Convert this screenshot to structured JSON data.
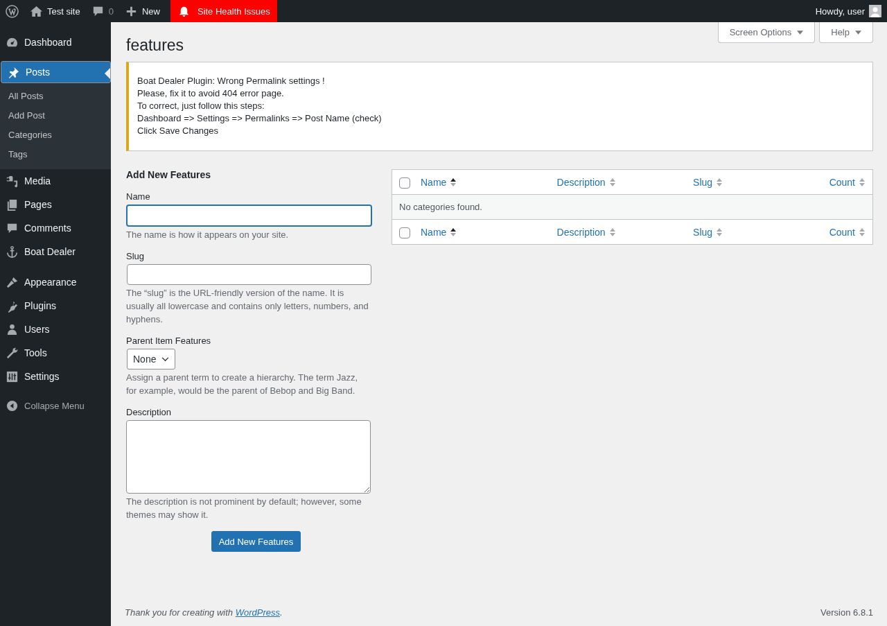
{
  "admin_bar": {
    "site": "Test site",
    "comments": "0",
    "new": "New",
    "alert": "Site Health Issues",
    "greeting": "Howdy, user"
  },
  "sidebar": {
    "groups": [
      [
        {
          "label": "Dashboard",
          "selected": false
        }
      ],
      [
        {
          "label": "Posts",
          "selected": true,
          "children": [
            {
              "label": "All Posts"
            },
            {
              "label": "Add Post"
            },
            {
              "label": "Categories"
            },
            {
              "label": "Tags"
            }
          ]
        },
        {
          "label": "Media",
          "selected": false
        },
        {
          "label": "Pages",
          "selected": false
        },
        {
          "label": "Comments",
          "selected": false
        },
        {
          "label": "Boat Dealer",
          "selected": false
        }
      ],
      [
        {
          "label": "Appearance",
          "selected": false
        },
        {
          "label": "Plugins",
          "selected": false
        },
        {
          "label": "Users",
          "selected": false
        },
        {
          "label": "Tools",
          "selected": false
        },
        {
          "label": "Settings",
          "selected": false
        }
      ]
    ],
    "collapse": "Collapse Menu"
  },
  "screen_options": "Screen Options",
  "help": "Help",
  "page_title": "features",
  "notice": [
    "Boat Dealer Plugin: Wrong Permalink settings !",
    "Please, fix it to avoid 404 error page.",
    "To correct, just follow this steps:",
    "Dashboard => Settings => Permalinks => Post Name (check)",
    "Click Save Changes"
  ],
  "form": {
    "title": "Add New Features",
    "fields": [
      {
        "kind": "text",
        "label": "Name",
        "focused": true,
        "help": "The name is how it appears on your site."
      },
      {
        "kind": "text",
        "label": "Slug",
        "focused": false,
        "help": "The “slug” is the URL-friendly version of the name. It is usually all lowercase and contains only letters, numbers, and hyphens."
      },
      {
        "kind": "select",
        "label": "Parent Item Features",
        "value": "None",
        "help": "Assign a parent term to create a hierarchy. The term Jazz, for example, would be the parent of Bebop and Big Band."
      },
      {
        "kind": "textarea",
        "label": "Description",
        "help": "The description is not prominent by default; however, some themes may show it."
      }
    ],
    "submit": "Add New Features"
  },
  "table": {
    "header_checked": false,
    "footer_checked": false,
    "columns": [
      {
        "label": "Name",
        "sorted": true
      },
      {
        "label": "Description",
        "sorted": false
      },
      {
        "label": "Slug",
        "sorted": false
      },
      {
        "label": "Count",
        "sorted": false
      }
    ],
    "empty": "No categories found.",
    "footer_columns": [
      {
        "label": "Name",
        "sorted": true
      },
      {
        "label": "Description",
        "sorted": false
      },
      {
        "label": "Slug",
        "sorted": false
      },
      {
        "label": "Count",
        "sorted": false
      }
    ]
  },
  "footer": {
    "thanks": "Thank you for creating with",
    "link": "WordPress",
    "after": ".",
    "version": "Version 6.8.1"
  }
}
